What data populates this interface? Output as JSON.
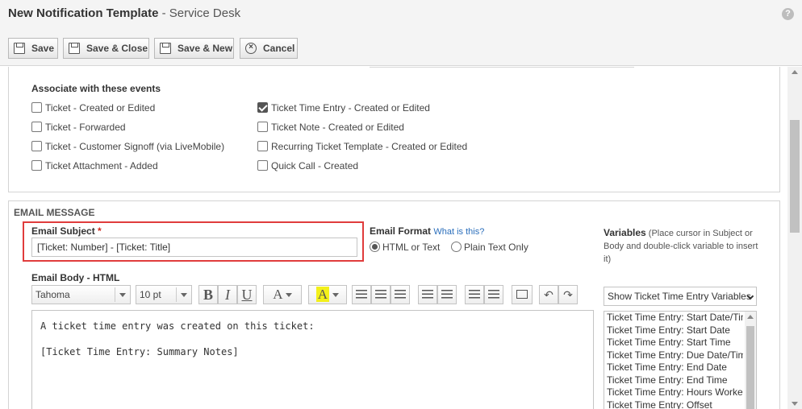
{
  "window": {
    "title": "New Notification Template",
    "subtitle": " - Service Desk"
  },
  "toolbar": {
    "save": "Save",
    "save_close": "Save & Close",
    "save_new": "Save & New",
    "cancel": "Cancel"
  },
  "events": {
    "title": "Associate with these events",
    "left": [
      {
        "label": "Ticket - Created or Edited",
        "checked": false
      },
      {
        "label": "Ticket - Forwarded",
        "checked": false
      },
      {
        "label": "Ticket - Customer Signoff (via LiveMobile)",
        "checked": false
      },
      {
        "label": "Ticket Attachment - Added",
        "checked": false
      }
    ],
    "right": [
      {
        "label": "Ticket Time Entry - Created or Edited",
        "checked": true
      },
      {
        "label": "Ticket Note - Created or Edited",
        "checked": false
      },
      {
        "label": "Recurring Ticket Template - Created or Edited",
        "checked": false
      },
      {
        "label": "Quick Call - Created",
        "checked": false
      }
    ]
  },
  "email": {
    "section_title": "EMAIL MESSAGE",
    "subject_label": "Email Subject",
    "required_mark": "*",
    "subject_value": "[Ticket: Number] - [Ticket: Title]",
    "format_label": "Email Format",
    "format_help": "What is this?",
    "format_html": "HTML or Text",
    "format_plain": "Plain Text Only",
    "format_selected": "html",
    "variables_label": "Variables",
    "variables_hint": "(Place cursor in Subject or Body and double-click variable to insert it)",
    "body_label": "Email Body - HTML",
    "font_name": "Tahoma",
    "font_size": "10 pt",
    "body_lines": [
      "A ticket time entry was created on this ticket:",
      "[Ticket Time Entry: Summary Notes]"
    ],
    "variables_filter": "Show Ticket Time Entry Variables",
    "variables_list": [
      "Ticket Time Entry: Start Date/Time",
      "Ticket Time Entry: Start Date",
      "Ticket Time Entry: Start Time",
      "Ticket Time Entry: Due Date/Time",
      "Ticket Time Entry: End Date",
      "Ticket Time Entry: End Time",
      "Ticket Time Entry: Hours Worked",
      "Ticket Time Entry: Offset"
    ]
  },
  "editor_buttons": {
    "bold": "B",
    "italic": "I",
    "underline": "U",
    "font_color": "A",
    "highlight": "A"
  }
}
